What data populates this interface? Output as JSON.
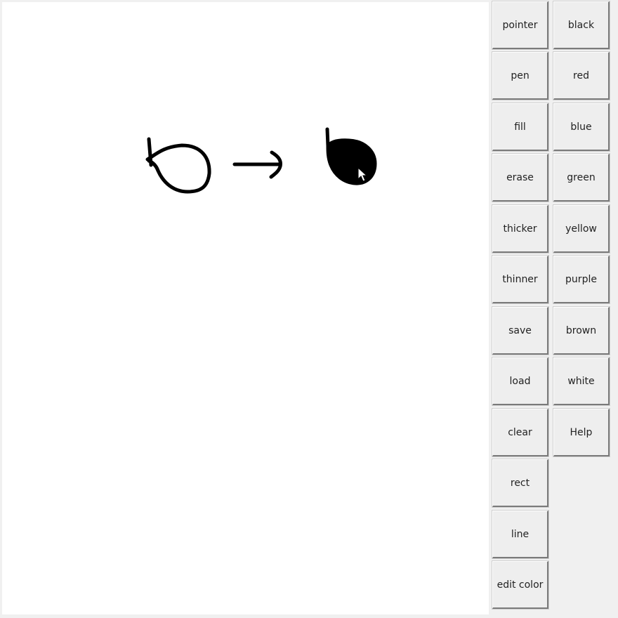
{
  "tools": {
    "pointer": "pointer",
    "pen": "pen",
    "fill": "fill",
    "erase": "erase",
    "thicker": "thicker",
    "thinner": "thinner",
    "save": "save",
    "load": "load",
    "clear": "clear",
    "rect": "rect",
    "line": "line",
    "edit_color": "edit color"
  },
  "colors": {
    "black": "black",
    "red": "red",
    "blue": "blue",
    "green": "green",
    "yellow": "yellow",
    "purple": "purple",
    "brown": "brown",
    "white": "white",
    "help": "Help"
  },
  "theme": {
    "stroke_color": "#000000",
    "canvas_color": "#ffffff",
    "button_color": "#eeeeee"
  }
}
